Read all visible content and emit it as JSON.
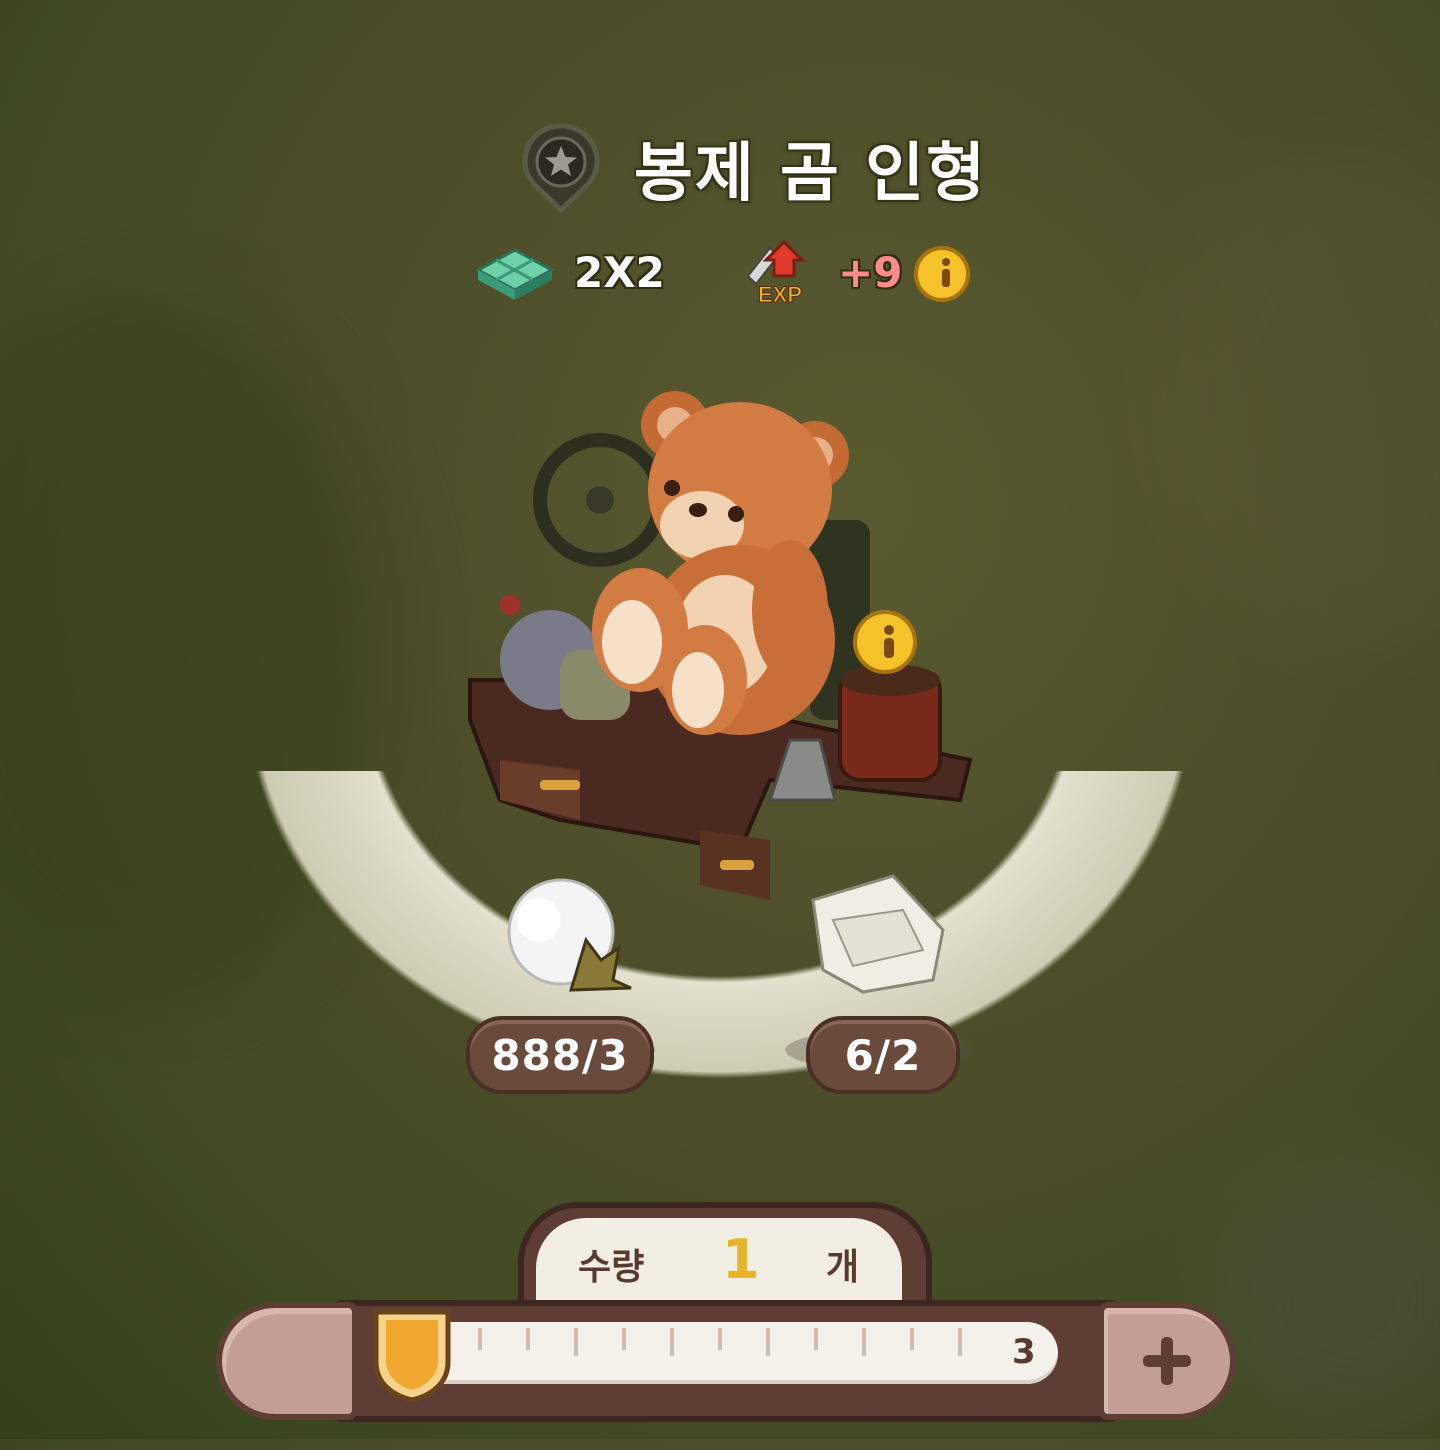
{
  "item": {
    "title": "봉제 곰 인형",
    "size": "2X2",
    "exp_bonus": "+9"
  },
  "materials": [
    {
      "name": "cotton",
      "count": "888/3"
    },
    {
      "name": "fabric",
      "count": "6/2"
    }
  ],
  "quantity": {
    "label": "수량",
    "value": "1",
    "unit": "개",
    "max": "3",
    "slider_fraction": 0.0
  },
  "icons": {
    "title": "star-pin-icon",
    "size": "tile-icon",
    "exp": "exp-up-icon",
    "info": "info-icon",
    "plus": "plus-icon",
    "minus": "minus-button"
  },
  "colors": {
    "accent_gold": "#e4b52a",
    "panel_brown": "#5e3e34",
    "exp_text": "#ff8a8a"
  }
}
